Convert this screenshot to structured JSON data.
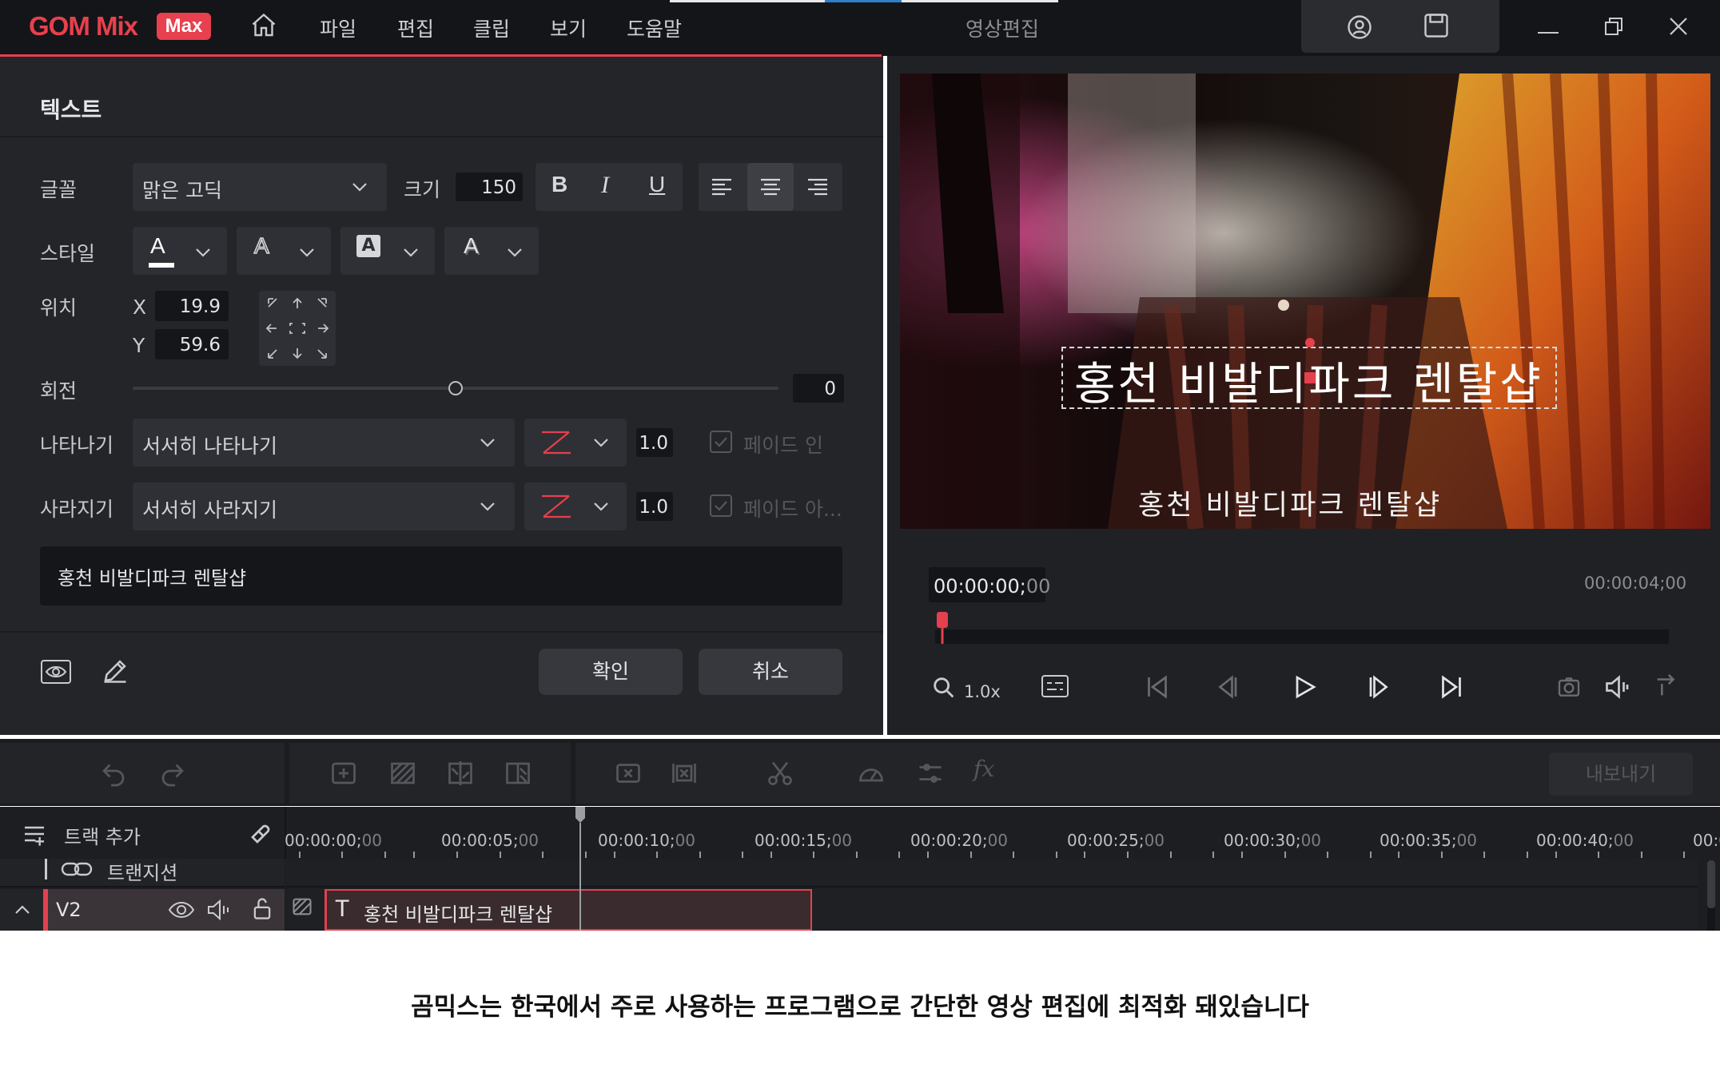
{
  "app": {
    "logo_text": "GOM Mix",
    "logo_badge": "Max",
    "window_title": "영상편집"
  },
  "menu": [
    "파일",
    "편집",
    "클립",
    "보기",
    "도움말"
  ],
  "colors": {
    "accent": "#e8404e",
    "panel": "#242529",
    "titlebar": "#141518",
    "active_tab": "#2d7fc7"
  },
  "text_panel": {
    "title": "텍스트",
    "font": {
      "label": "글꼴",
      "value": "맑은 고딕"
    },
    "size": {
      "label": "크기",
      "value": "150"
    },
    "format_buttons": [
      "B",
      "I",
      "U"
    ],
    "align_buttons": [
      "align-left",
      "align-center",
      "align-right"
    ],
    "style": {
      "label": "스타일",
      "icons": [
        "font-color-icon",
        "outline-icon",
        "background-icon",
        "shadow-icon"
      ]
    },
    "position": {
      "label": "위치",
      "x_label": "X",
      "x": "19.9",
      "y_label": "Y",
      "y": "59.6"
    },
    "rotation": {
      "label": "회전",
      "value": "0",
      "fraction": 0.5
    },
    "appear": {
      "label": "나타나기",
      "effect": "서서히 나타나기",
      "duration": "1.0",
      "fade_label": "페이드 인"
    },
    "disappear": {
      "label": "사라지기",
      "effect": "서서히 사라지기",
      "duration": "1.0",
      "fade_label": "페이드 아..."
    },
    "text_value": "홍천 비발디파크 렌탈샵",
    "confirm": "확인",
    "cancel": "취소"
  },
  "preview": {
    "caption_main": "홍천 비발디파크 렌탈샵",
    "caption_sub": "홍천 비발디파크 렌탈샵",
    "current_time_main": "00:00:00;",
    "current_time_frames": "00",
    "total_time": "00:00:04;00",
    "zoom": "1.0x"
  },
  "timeline": {
    "export": "내보내기",
    "add_track": "트랙 추가",
    "ticks": [
      {
        "main": "00:00:00;",
        "f": "00"
      },
      {
        "main": "00:00:05;",
        "f": "00"
      },
      {
        "main": "00:00:10;",
        "f": "00"
      },
      {
        "main": "00:00:15;",
        "f": "00"
      },
      {
        "main": "00:00:20;",
        "f": "00"
      },
      {
        "main": "00:00:25;",
        "f": "00"
      },
      {
        "main": "00:00:30;",
        "f": "00"
      },
      {
        "main": "00:00:35;",
        "f": "00"
      },
      {
        "main": "00:00:40;",
        "f": "00"
      },
      {
        "main": "00:0",
        "f": ""
      }
    ],
    "transition_track": "트랜지션",
    "track_v2": "V2",
    "clip_text": "홍천 비발디파크 렌탈샵"
  },
  "caption": "곰믹스는 한국에서 주로 사용하는 프로그램으로 간단한 영상 편집에 최적화 돼있습니다"
}
